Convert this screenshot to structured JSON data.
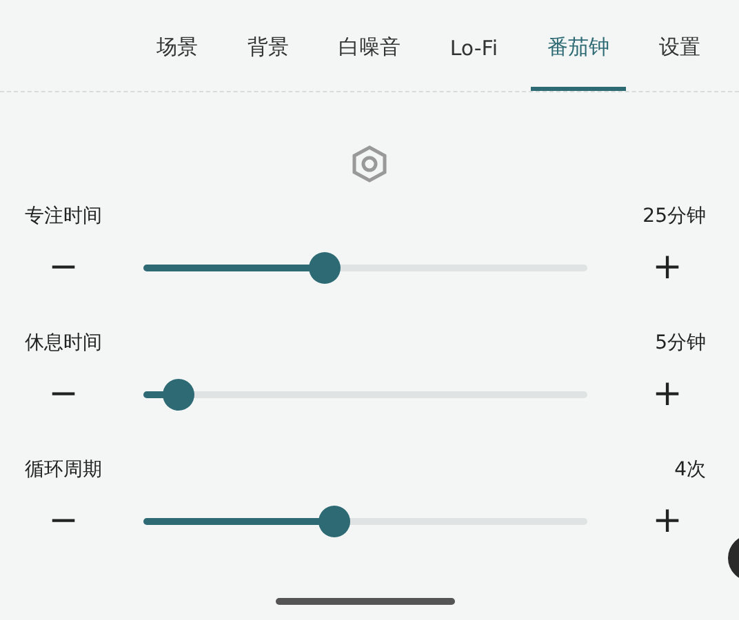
{
  "tabs": [
    {
      "label": "场景",
      "selected": false
    },
    {
      "label": "背景",
      "selected": false
    },
    {
      "label": "白噪音",
      "selected": false
    },
    {
      "label": "Lo-Fi",
      "selected": false
    },
    {
      "label": "番茄钟",
      "selected": true
    },
    {
      "label": "设置",
      "selected": false
    }
  ],
  "settings": [
    {
      "label": "专注时间",
      "reading": "25分钟",
      "minus": "−",
      "plus": "+",
      "level": 0.407
    },
    {
      "label": "休息时间",
      "reading": "5分钟",
      "minus": "−",
      "plus": "+",
      "level": 0.077
    },
    {
      "label": "循环周期",
      "reading": "4次",
      "minus": "−",
      "plus": "+",
      "level": 0.43
    }
  ]
}
